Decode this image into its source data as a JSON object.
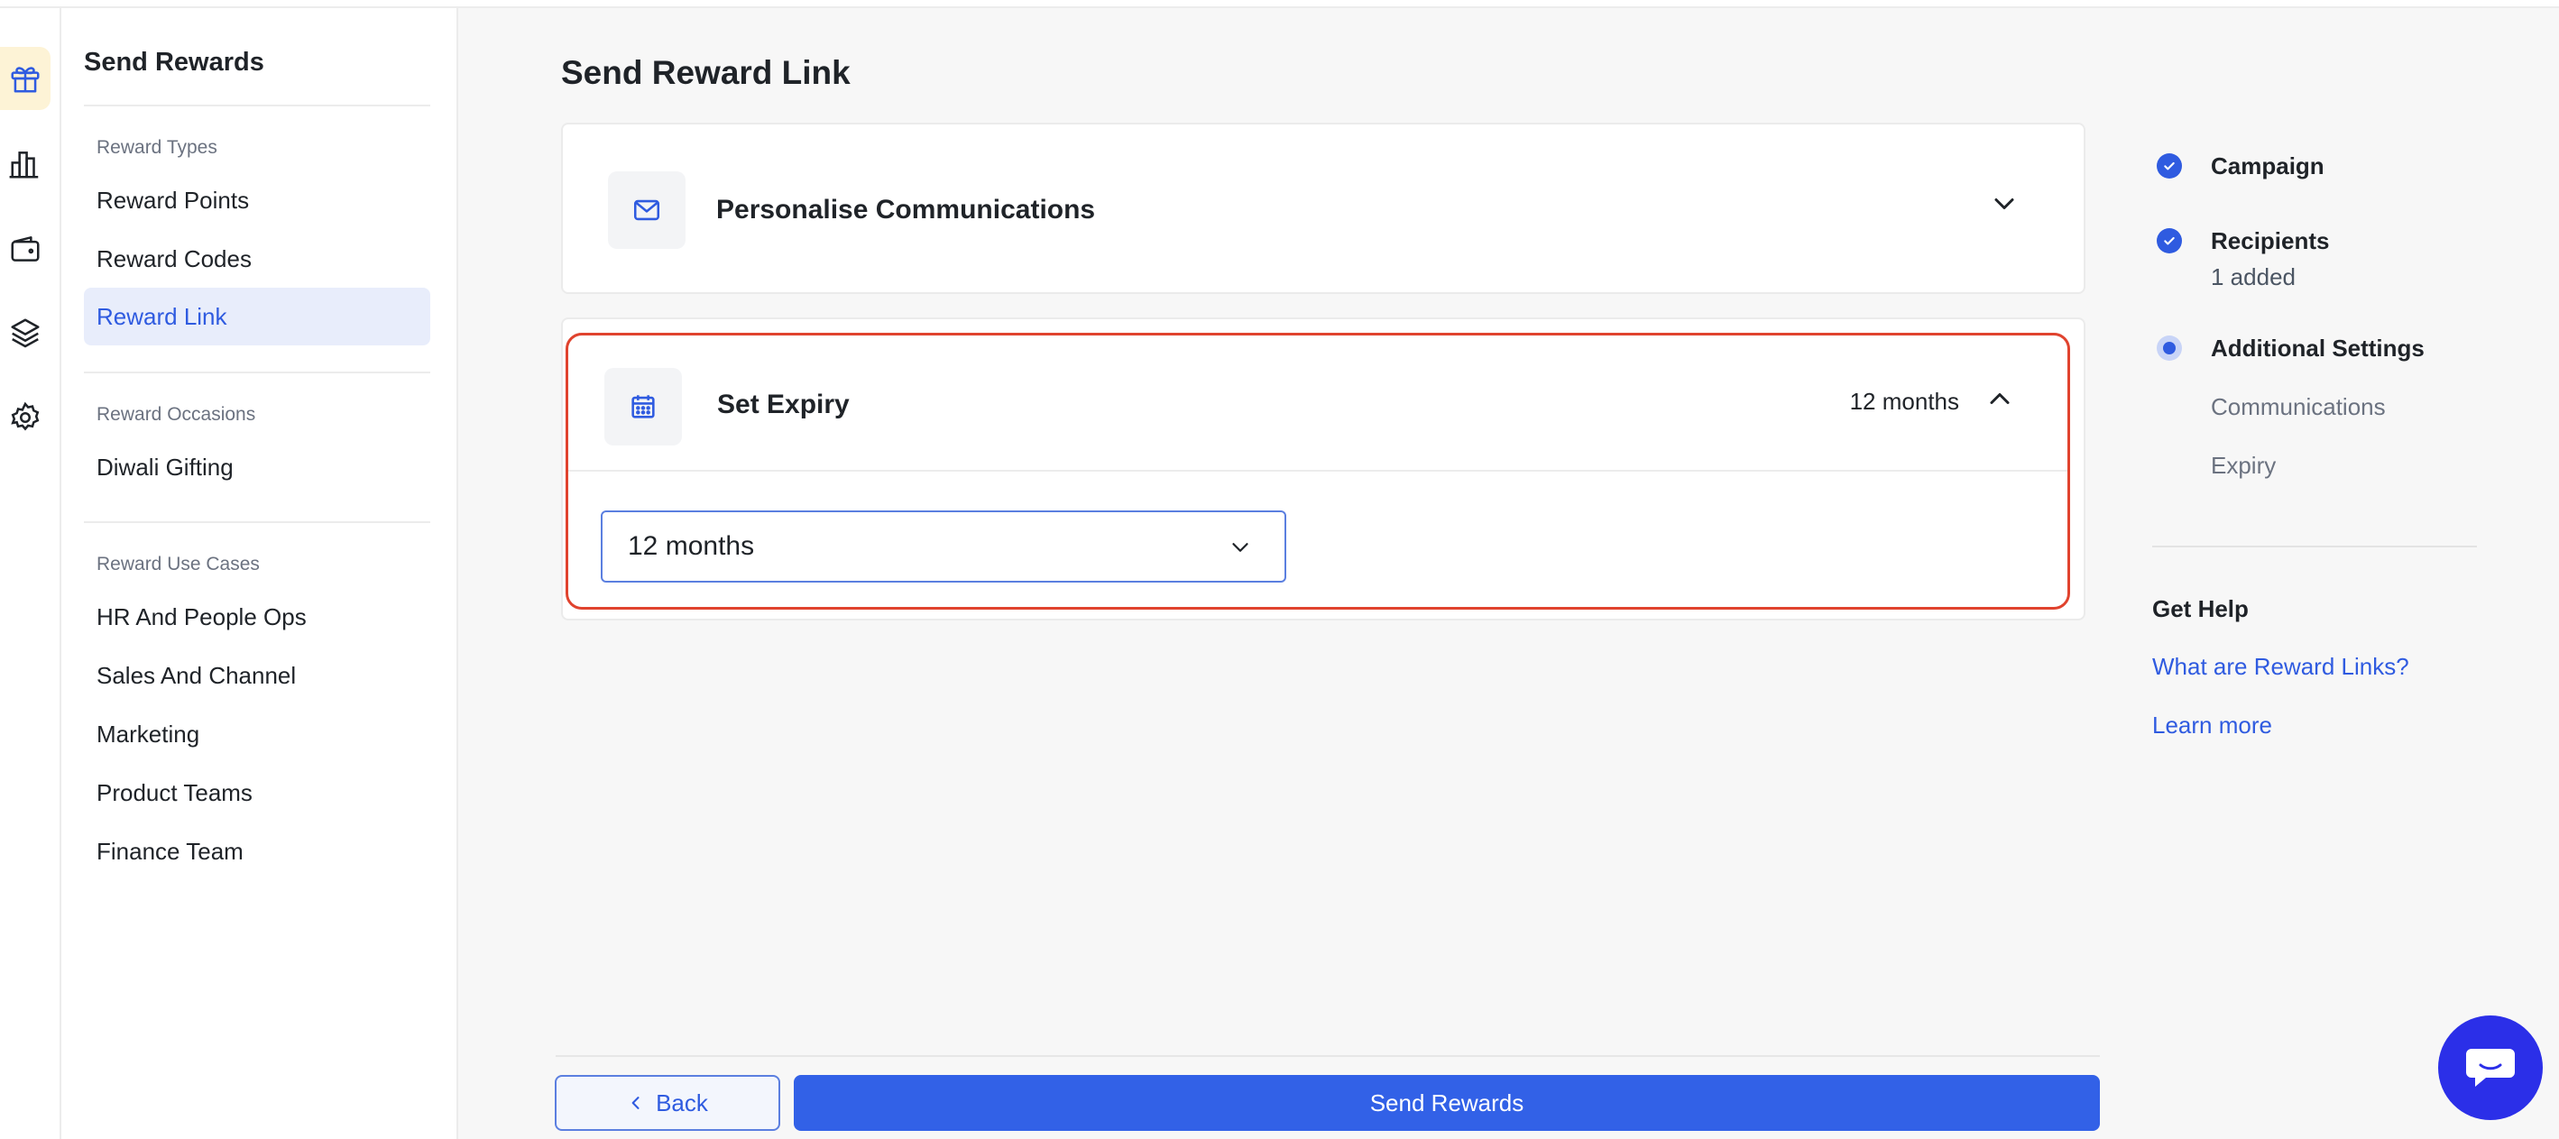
{
  "sidebar": {
    "title": "Send Rewards",
    "sections": [
      {
        "label": "Reward Types",
        "items": [
          "Reward Points",
          "Reward Codes",
          "Reward Link"
        ]
      },
      {
        "label": "Reward Occasions",
        "items": [
          "Diwali Gifting"
        ]
      },
      {
        "label": "Reward Use Cases",
        "items": [
          "HR And People Ops",
          "Sales And Channel",
          "Marketing",
          "Product Teams",
          "Finance Team"
        ]
      }
    ],
    "active_item": "Reward Link"
  },
  "rail": {
    "icons": [
      "gift-icon",
      "bar-chart-icon",
      "wallet-icon",
      "layers-icon",
      "gear-icon"
    ],
    "active_icon": "gift-icon"
  },
  "main": {
    "title": "Send Reward Link",
    "sections": {
      "communications": {
        "title": "Personalise Communications",
        "icon": "mail-icon",
        "expanded": false
      },
      "expiry": {
        "title": "Set Expiry",
        "icon": "calendar-icon",
        "value": "12 months",
        "expanded": true,
        "select_value": "12 months"
      }
    }
  },
  "footer": {
    "back_label": "Back",
    "send_label": "Send Rewards"
  },
  "steps": [
    {
      "title": "Campaign",
      "state": "done"
    },
    {
      "title": "Recipients",
      "subtitle": "1 added",
      "state": "done"
    },
    {
      "title": "Additional Settings",
      "state": "current",
      "children": [
        "Communications",
        "Expiry"
      ]
    }
  ],
  "help": {
    "title": "Get Help",
    "links": [
      "What are Reward Links?",
      "Learn more"
    ]
  },
  "colors": {
    "accent": "#3261e7",
    "highlight_border": "#e0432e",
    "active_bg": "#e8edfb",
    "chat_button": "#2b2fe8"
  }
}
